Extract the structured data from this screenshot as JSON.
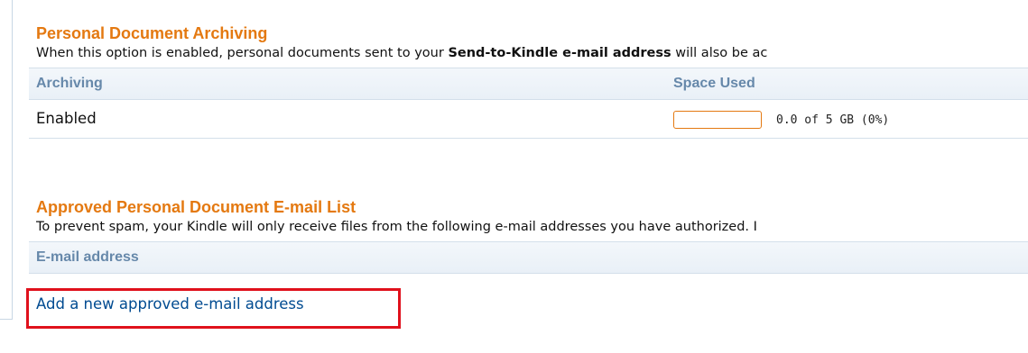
{
  "archiving": {
    "title": "Personal Document Archiving",
    "desc_prefix": "When this option is enabled, personal documents sent to your ",
    "desc_bold": "Send-to-Kindle e-mail address",
    "desc_suffix": " will also be ac",
    "columns": {
      "archiving": "Archiving",
      "space_used": "Space Used"
    },
    "row": {
      "status": "Enabled",
      "space_text": "0.0 of 5 GB (0%)",
      "space_fraction": 0
    }
  },
  "approved": {
    "title": "Approved Personal Document E-mail List",
    "desc": "To prevent spam, your Kindle will only receive files from the following e-mail addresses you have authorized. I",
    "columns": {
      "email": "E-mail address"
    },
    "add_link": "Add a new approved e-mail address"
  },
  "colors": {
    "title": "#e47911",
    "header_text": "#6688aa",
    "link": "#004b91",
    "highlight": "#e0111c",
    "progress_border": "#e47911"
  }
}
